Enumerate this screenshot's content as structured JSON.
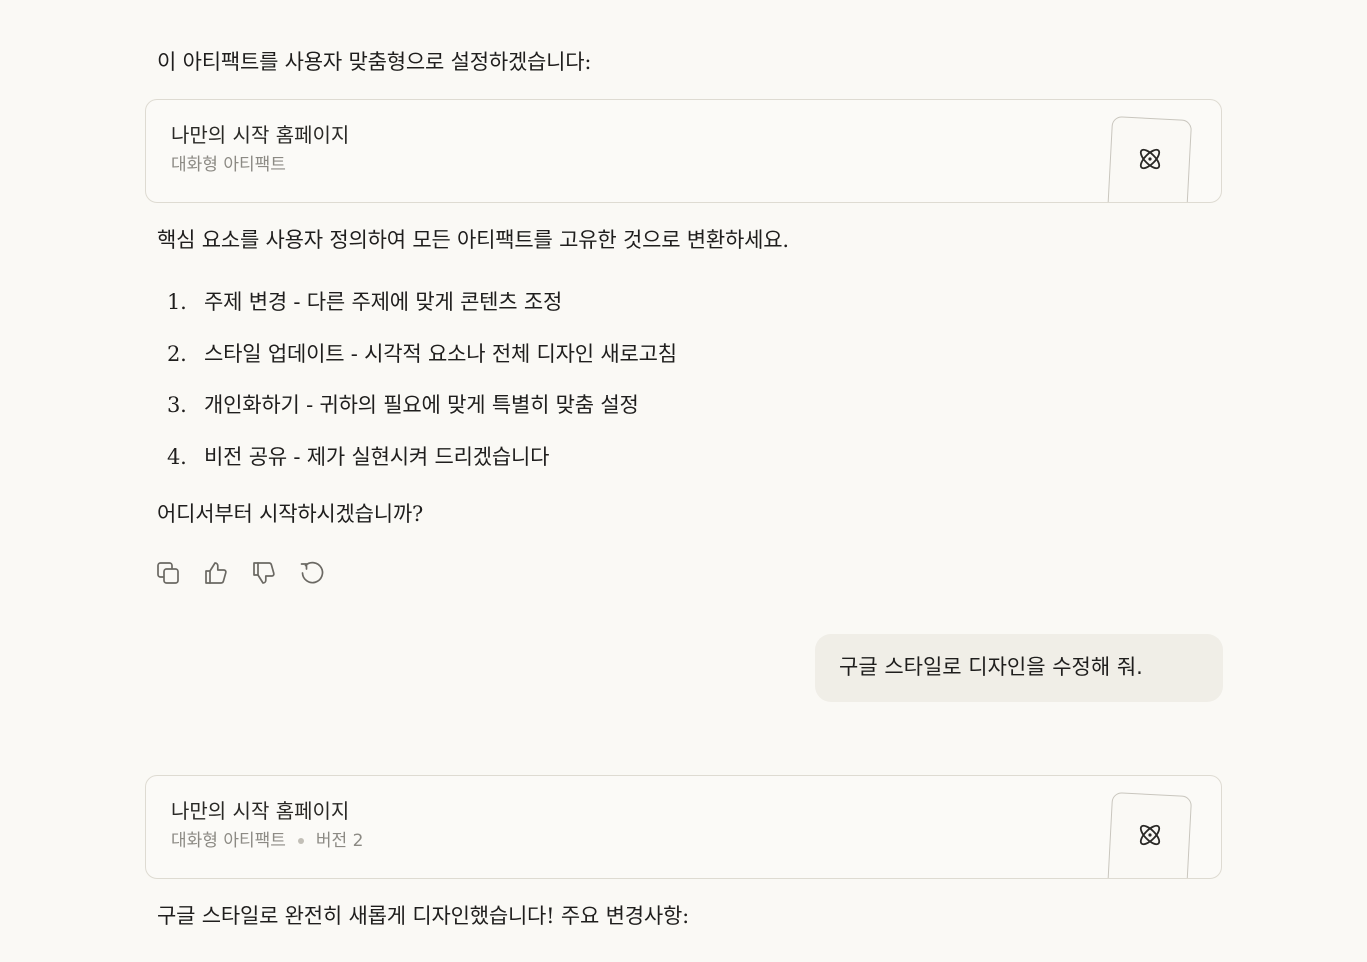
{
  "messages": {
    "intro_text": "이 아티팩트를 사용자 맞춤형으로 설정하겠습니다:",
    "artifact1": {
      "title": "나만의 시작 홈페이지",
      "type": "대화형 아티팩트",
      "icon": "atom-icon"
    },
    "description": "핵심 요소를 사용자 정의하여 모든 아티팩트를 고유한 것으로 변환하세요.",
    "options": [
      {
        "num": "1.",
        "text": "주제 변경 - 다른 주제에 맞게 콘텐츠 조정"
      },
      {
        "num": "2.",
        "text": "스타일 업데이트 - 시각적 요소나 전체 디자인 새로고침"
      },
      {
        "num": "3.",
        "text": "개인화하기 - 귀하의 필요에 맞게 특별히 맞춤 설정"
      },
      {
        "num": "4.",
        "text": "비전 공유 - 제가 실현시켜 드리겠습니다"
      }
    ],
    "question": "어디서부터 시작하시겠습니까?",
    "actions": [
      "copy-icon",
      "thumbs-up-icon",
      "thumbs-down-icon",
      "retry-icon"
    ],
    "user_message": "구글 스타일로 디자인을 수정해 줘.",
    "artifact2": {
      "title": "나만의 시작 홈페이지",
      "type": "대화형 아티팩트",
      "version": "버전 2",
      "icon": "atom-icon"
    },
    "response_text": "구글 스타일로 완전히 새롭게 디자인했습니다! 주요 변경사항:"
  }
}
